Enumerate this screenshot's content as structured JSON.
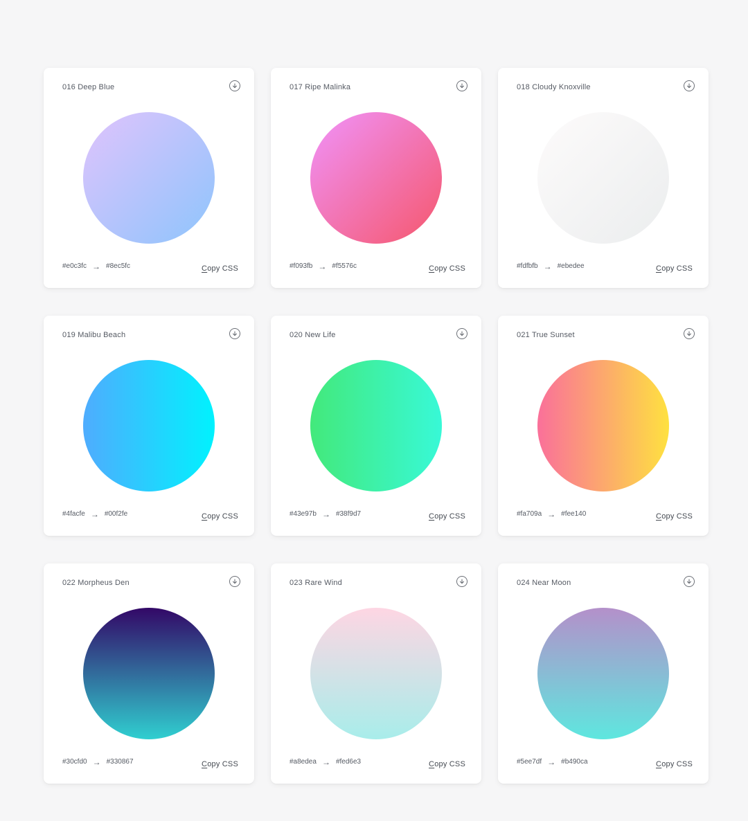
{
  "gradients": [
    {
      "name": "016 Deep Blue",
      "from": "#e0c3fc",
      "to": "#8ec5fc",
      "angle": "135deg"
    },
    {
      "name": "017 Ripe Malinka",
      "from": "#f093fb",
      "to": "#f5576c",
      "angle": "135deg"
    },
    {
      "name": "018 Cloudy Knoxville",
      "from": "#fdfbfb",
      "to": "#ebedee",
      "angle": "135deg"
    },
    {
      "name": "019 Malibu Beach",
      "from": "#4facfe",
      "to": "#00f2fe",
      "angle": "90deg"
    },
    {
      "name": "020 New Life",
      "from": "#43e97b",
      "to": "#38f9d7",
      "angle": "90deg"
    },
    {
      "name": "021 True Sunset",
      "from": "#fa709a",
      "to": "#fee140",
      "angle": "90deg"
    },
    {
      "name": "022 Morpheus Den",
      "from": "#30cfd0",
      "to": "#330867",
      "angle": "0deg"
    },
    {
      "name": "023 Rare Wind",
      "from": "#a8edea",
      "to": "#fed6e3",
      "angle": "0deg"
    },
    {
      "name": "024 Near Moon",
      "from": "#5ee7df",
      "to": "#b490ca",
      "angle": "0deg"
    }
  ],
  "labels": {
    "arrow": "→",
    "copy_first": "C",
    "copy_rest": "opy CSS"
  },
  "icons": {
    "download": "download-icon"
  }
}
